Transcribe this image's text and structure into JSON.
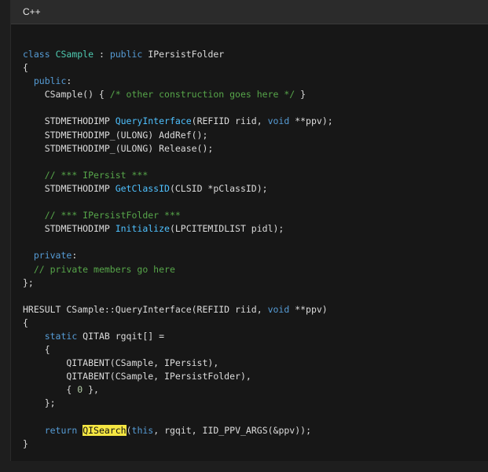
{
  "code_block": {
    "language": "C++",
    "lines": [
      [
        {
          "t": "class",
          "c": "kw"
        },
        {
          "t": " ",
          "c": ""
        },
        {
          "t": "CSample",
          "c": "ty"
        },
        {
          "t": " : ",
          "c": ""
        },
        {
          "t": "public",
          "c": "kw"
        },
        {
          "t": " IPersistFolder",
          "c": ""
        }
      ],
      [
        {
          "t": "{",
          "c": ""
        }
      ],
      [
        {
          "t": "  ",
          "c": ""
        },
        {
          "t": "public",
          "c": "kw"
        },
        {
          "t": ":",
          "c": ""
        }
      ],
      [
        {
          "t": "    CSample() { ",
          "c": ""
        },
        {
          "t": "/* other construction goes here */",
          "c": "cm"
        },
        {
          "t": " }",
          "c": ""
        }
      ],
      [],
      [
        {
          "t": "    STDMETHODIMP ",
          "c": ""
        },
        {
          "t": "QueryInterface",
          "c": "fn"
        },
        {
          "t": "(REFIID riid, ",
          "c": ""
        },
        {
          "t": "void",
          "c": "kw"
        },
        {
          "t": " **ppv);",
          "c": ""
        }
      ],
      [
        {
          "t": "    STDMETHODIMP_(ULONG) AddRef();",
          "c": ""
        }
      ],
      [
        {
          "t": "    STDMETHODIMP_(ULONG) Release();",
          "c": ""
        }
      ],
      [],
      [
        {
          "t": "    ",
          "c": ""
        },
        {
          "t": "// *** IPersist ***",
          "c": "cm"
        }
      ],
      [
        {
          "t": "    STDMETHODIMP ",
          "c": ""
        },
        {
          "t": "GetClassID",
          "c": "fn"
        },
        {
          "t": "(CLSID *pClassID);",
          "c": ""
        }
      ],
      [],
      [
        {
          "t": "    ",
          "c": ""
        },
        {
          "t": "// *** IPersistFolder ***",
          "c": "cm"
        }
      ],
      [
        {
          "t": "    STDMETHODIMP ",
          "c": ""
        },
        {
          "t": "Initialize",
          "c": "fn"
        },
        {
          "t": "(LPCITEMIDLIST pidl);",
          "c": ""
        }
      ],
      [],
      [
        {
          "t": "  ",
          "c": ""
        },
        {
          "t": "private",
          "c": "kw"
        },
        {
          "t": ":",
          "c": ""
        }
      ],
      [
        {
          "t": "  ",
          "c": ""
        },
        {
          "t": "// private members go here",
          "c": "cm"
        }
      ],
      [
        {
          "t": "};",
          "c": ""
        }
      ],
      [],
      [
        {
          "t": "HRESULT CSample::QueryInterface(REFIID riid, ",
          "c": ""
        },
        {
          "t": "void",
          "c": "kw"
        },
        {
          "t": " **ppv)",
          "c": ""
        }
      ],
      [
        {
          "t": "{",
          "c": ""
        }
      ],
      [
        {
          "t": "    ",
          "c": ""
        },
        {
          "t": "static",
          "c": "kw"
        },
        {
          "t": " QITAB rgqit[] =",
          "c": ""
        }
      ],
      [
        {
          "t": "    {",
          "c": ""
        }
      ],
      [
        {
          "t": "        QITABENT(CSample, IPersist),",
          "c": ""
        }
      ],
      [
        {
          "t": "        QITABENT(CSample, IPersistFolder),",
          "c": ""
        }
      ],
      [
        {
          "t": "        { ",
          "c": ""
        },
        {
          "t": "0",
          "c": "nm"
        },
        {
          "t": " },",
          "c": ""
        }
      ],
      [
        {
          "t": "    };",
          "c": ""
        }
      ],
      [],
      [
        {
          "t": "    ",
          "c": ""
        },
        {
          "t": "return",
          "c": "kw"
        },
        {
          "t": " ",
          "c": ""
        },
        {
          "t": "QISearch",
          "c": "hl"
        },
        {
          "t": "(",
          "c": ""
        },
        {
          "t": "this",
          "c": "kw"
        },
        {
          "t": ", rgqit, IID_PPV_ARGS(&ppv));",
          "c": ""
        }
      ],
      [
        {
          "t": "}",
          "c": ""
        }
      ]
    ]
  }
}
